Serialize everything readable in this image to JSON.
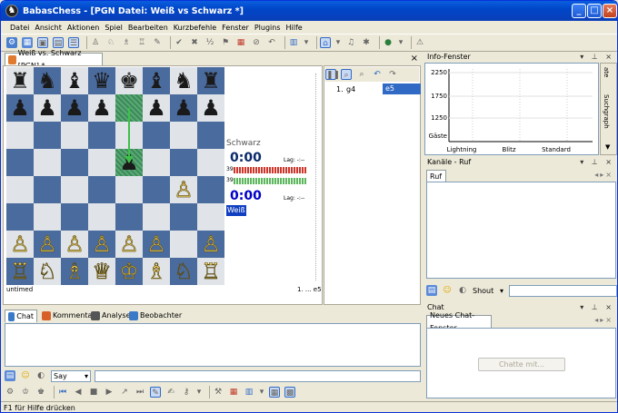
{
  "window": {
    "title": "BabasChess - [PGN Datei: Weiß vs Schwarz *]"
  },
  "menu": [
    "Datei",
    "Ansicht",
    "Aktionen",
    "Spiel",
    "Bearbeiten",
    "Kurzbefehle",
    "Fenster",
    "Plugins",
    "Hilfe"
  ],
  "doc_tab": {
    "label": "Weiß vs. Schwarz [PGN] *",
    "close": "×"
  },
  "board": {
    "rows": [
      [
        "♜",
        "♞",
        "♝",
        "♛",
        "♚",
        "♝",
        "♞",
        "♜"
      ],
      [
        "♟",
        "♟",
        "♟",
        "♟",
        "",
        "♟",
        "♟",
        "♟"
      ],
      [
        "",
        "",
        "",
        "",
        "",
        "",
        "",
        ""
      ],
      [
        "",
        "",
        "",
        "",
        "♟",
        "",
        "",
        ""
      ],
      [
        "",
        "",
        "",
        "",
        "",
        "",
        "♙",
        ""
      ],
      [
        "",
        "",
        "",
        "",
        "",
        "",
        "",
        ""
      ],
      [
        "♙",
        "♙",
        "♙",
        "♙",
        "♙",
        "♙",
        "",
        "♙"
      ],
      [
        "♖",
        "♘",
        "♗",
        "♕",
        "♔",
        "♗",
        "♘",
        "♖"
      ]
    ],
    "footer_left": "untimed",
    "footer_right": "1. ... e5"
  },
  "players": {
    "black": {
      "name": "Schwarz",
      "clock": "0:00",
      "lag": "Lag: -:--",
      "bar_value": "39"
    },
    "white": {
      "name": "Weiß",
      "clock": "0:00",
      "lag": "Lag: -:--",
      "bar_value": "39"
    }
  },
  "moves": {
    "number": "1.",
    "white": "g4",
    "black": "e5"
  },
  "info": {
    "title": "Info-Fenster",
    "side_tabs": [
      "ate",
      "Suchgraph"
    ],
    "chart_data": {
      "type": "line",
      "yticks": [
        "2250",
        "1750",
        "1250",
        "Gäste"
      ],
      "categories": [
        "Lightning",
        "Blitz",
        "Standard"
      ]
    }
  },
  "channels": {
    "title": "Kanäle - Ruf",
    "tab": "Ruf",
    "shout_label": "Shout"
  },
  "chat": {
    "title": "Chat",
    "tab": "Neues Chat-Fenster",
    "button": "Chatte mit..."
  },
  "bottom_tabs": [
    "Chat",
    "Kommentar",
    "Analyse",
    "Beobachter"
  ],
  "say_label": "Say",
  "status": "F1 für Hilfe drücken"
}
